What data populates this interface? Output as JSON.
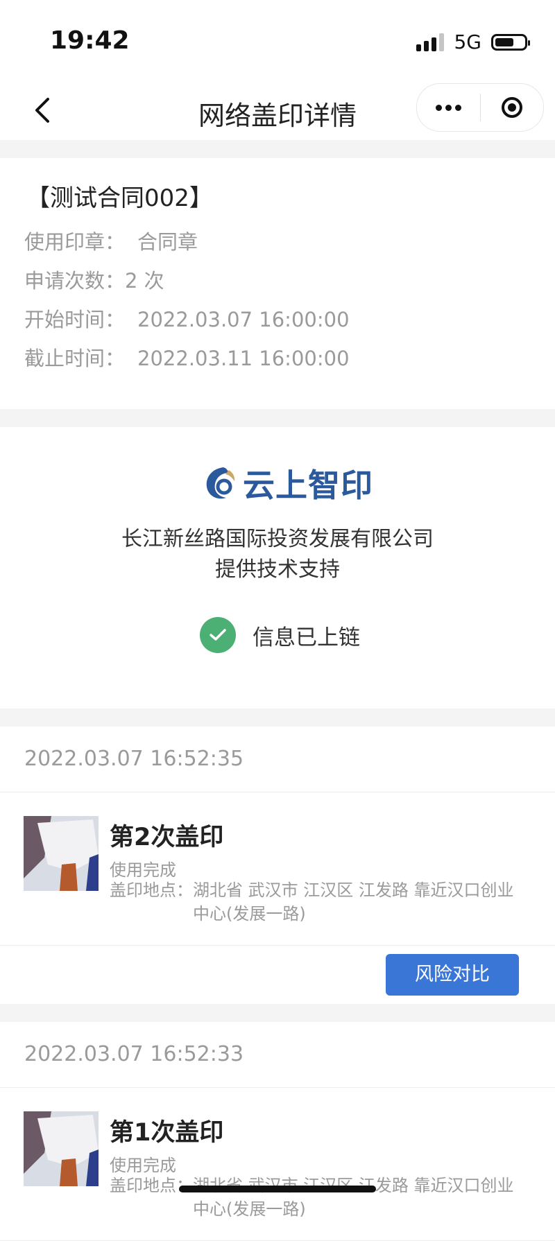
{
  "status_bar": {
    "time": "19:42",
    "network": "5G"
  },
  "nav": {
    "title": "网络盖印详情"
  },
  "contract": {
    "title": "【测试合同002】",
    "rows": [
      {
        "label": "使用印章：",
        "value": "合同章"
      },
      {
        "label": "申请次数：",
        "value": "2 次"
      },
      {
        "label": "开始时间：",
        "value": "2022.03.07 16:00:00"
      },
      {
        "label": "截止时间：",
        "value": "2022.03.11 16:00:00"
      }
    ]
  },
  "support": {
    "logo_text": "云上智印",
    "company_line1": "长江新丝路国际投资发展有限公司",
    "company_line2": "提供技术支持",
    "chain_status": "信息已上链"
  },
  "records": [
    {
      "datetime": "2022.03.07 16:52:35",
      "title": "第2次盖印",
      "status": "使用完成",
      "location_label": "盖印地点：",
      "location": "湖北省 武汉市 江汉区 江发路 靠近汉口创业中心(发展一路)",
      "action": "风险对比"
    },
    {
      "datetime": "2022.03.07 16:52:33",
      "title": "第1次盖印",
      "status": "使用完成",
      "location_label": "盖印地点：",
      "location": "湖北省 武汉市 江汉区 江发路 靠近汉口创业中心(发展一路)"
    }
  ],
  "colors": {
    "accent": "#3a76d6",
    "success": "#4caf73",
    "logo": "#2a5a9c"
  }
}
